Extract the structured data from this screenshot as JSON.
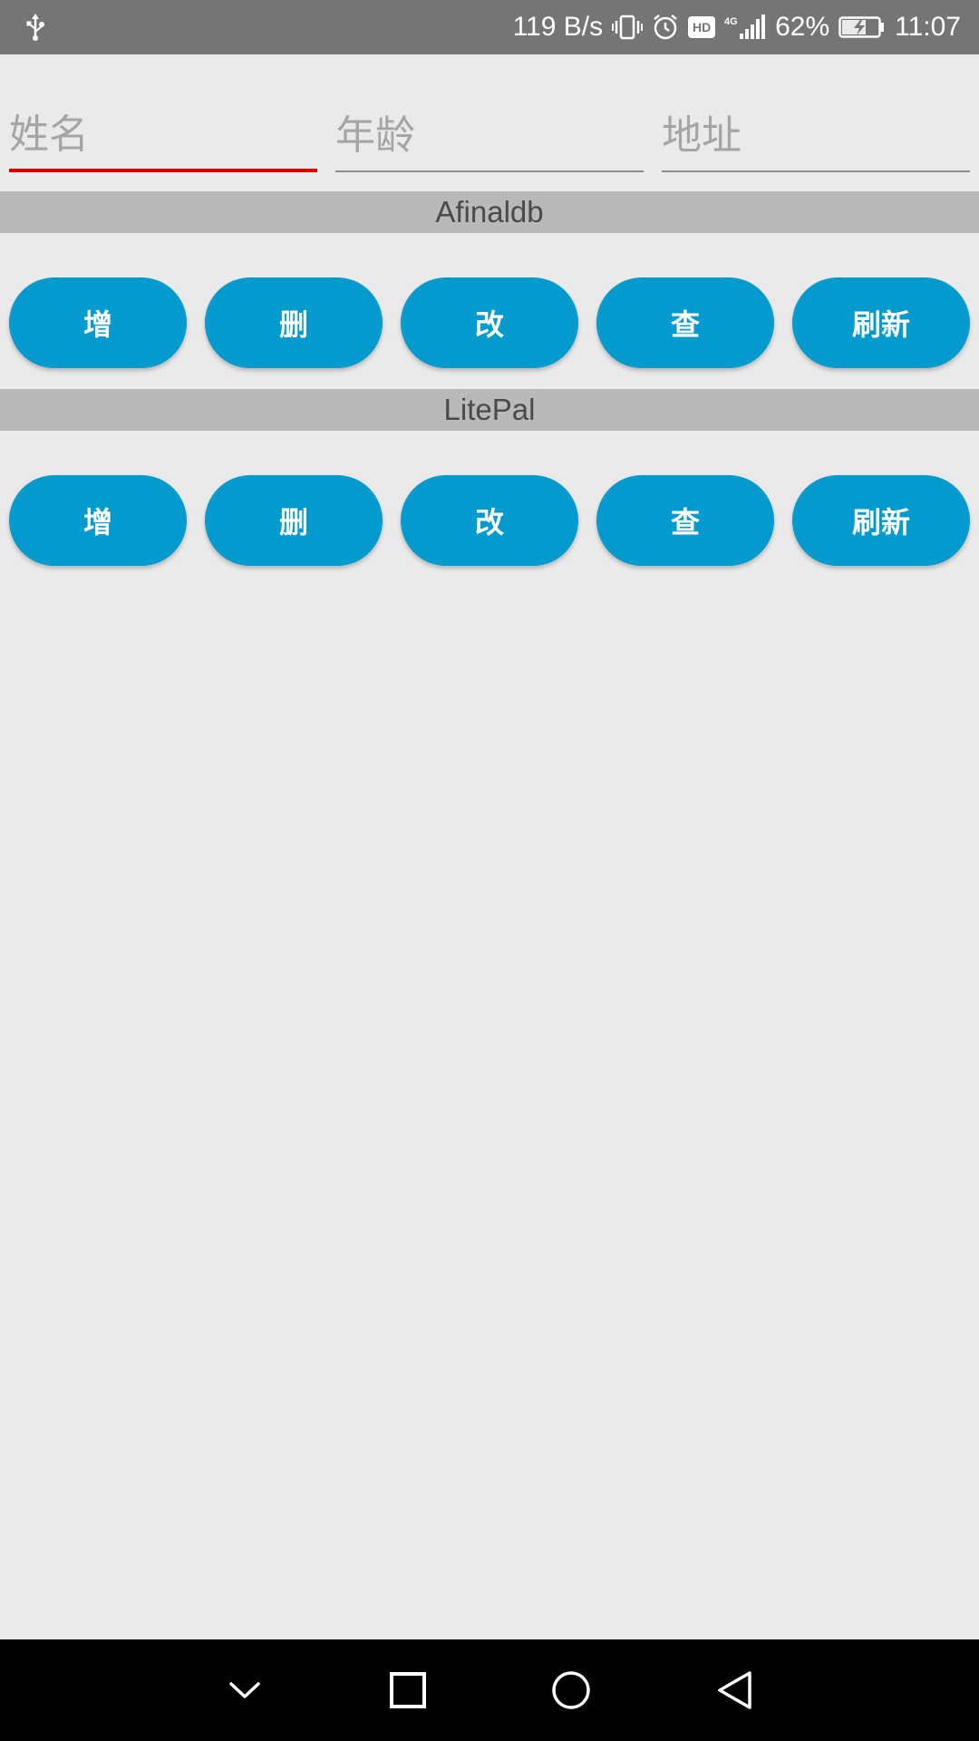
{
  "status_bar": {
    "network_speed": "119 B/s",
    "battery_percent": "62%",
    "time": "11:07",
    "hd_badge": "HD",
    "icons": [
      "usb-icon",
      "vibrate-icon",
      "alarm-icon",
      "hd-icon",
      "signal-4g-icon",
      "battery-charging-icon"
    ]
  },
  "form": {
    "name": {
      "placeholder": "姓名",
      "value": ""
    },
    "age": {
      "placeholder": "年龄",
      "value": ""
    },
    "address": {
      "placeholder": "地址",
      "value": ""
    }
  },
  "sections": [
    {
      "title": "Afinaldb",
      "buttons": {
        "add": "增",
        "delete": "删",
        "update": "改",
        "query": "查",
        "refresh": "刷新"
      }
    },
    {
      "title": "LitePal",
      "buttons": {
        "add": "增",
        "delete": "删",
        "update": "改",
        "query": "查",
        "refresh": "刷新"
      }
    }
  ],
  "colors": {
    "accent_button": "#039ACE",
    "focus_underline": "#D50000",
    "section_header_bg": "#B9B9B9",
    "background": "#EAEAEB"
  },
  "nav_bar": {
    "icons": [
      "chevron-down-icon",
      "square-icon",
      "circle-icon",
      "back-triangle-icon"
    ]
  }
}
